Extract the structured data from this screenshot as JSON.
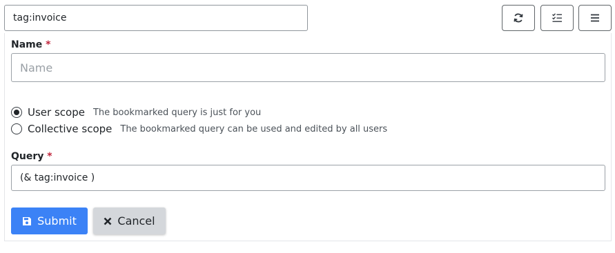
{
  "search": {
    "value": "tag:invoice"
  },
  "toolbar": {
    "refresh_icon": "refresh-icon",
    "select_icon": "checklist-icon",
    "menu_icon": "menu-icon"
  },
  "form": {
    "name_label": "Name",
    "required_marker": "*",
    "name_placeholder": "Name",
    "name_value": "",
    "scope_options": [
      {
        "label": "User scope",
        "description": "The bookmarked query is just for you",
        "checked": true
      },
      {
        "label": "Collective scope",
        "description": "The bookmarked query can be used and edited by all users",
        "checked": false
      }
    ],
    "query_label": "Query",
    "query_value": "(& tag:invoice )",
    "submit_label": "Submit",
    "cancel_label": "Cancel"
  },
  "colors": {
    "primary": "#3b82f6",
    "secondary": "#d4d7db",
    "required": "#c0263d"
  }
}
